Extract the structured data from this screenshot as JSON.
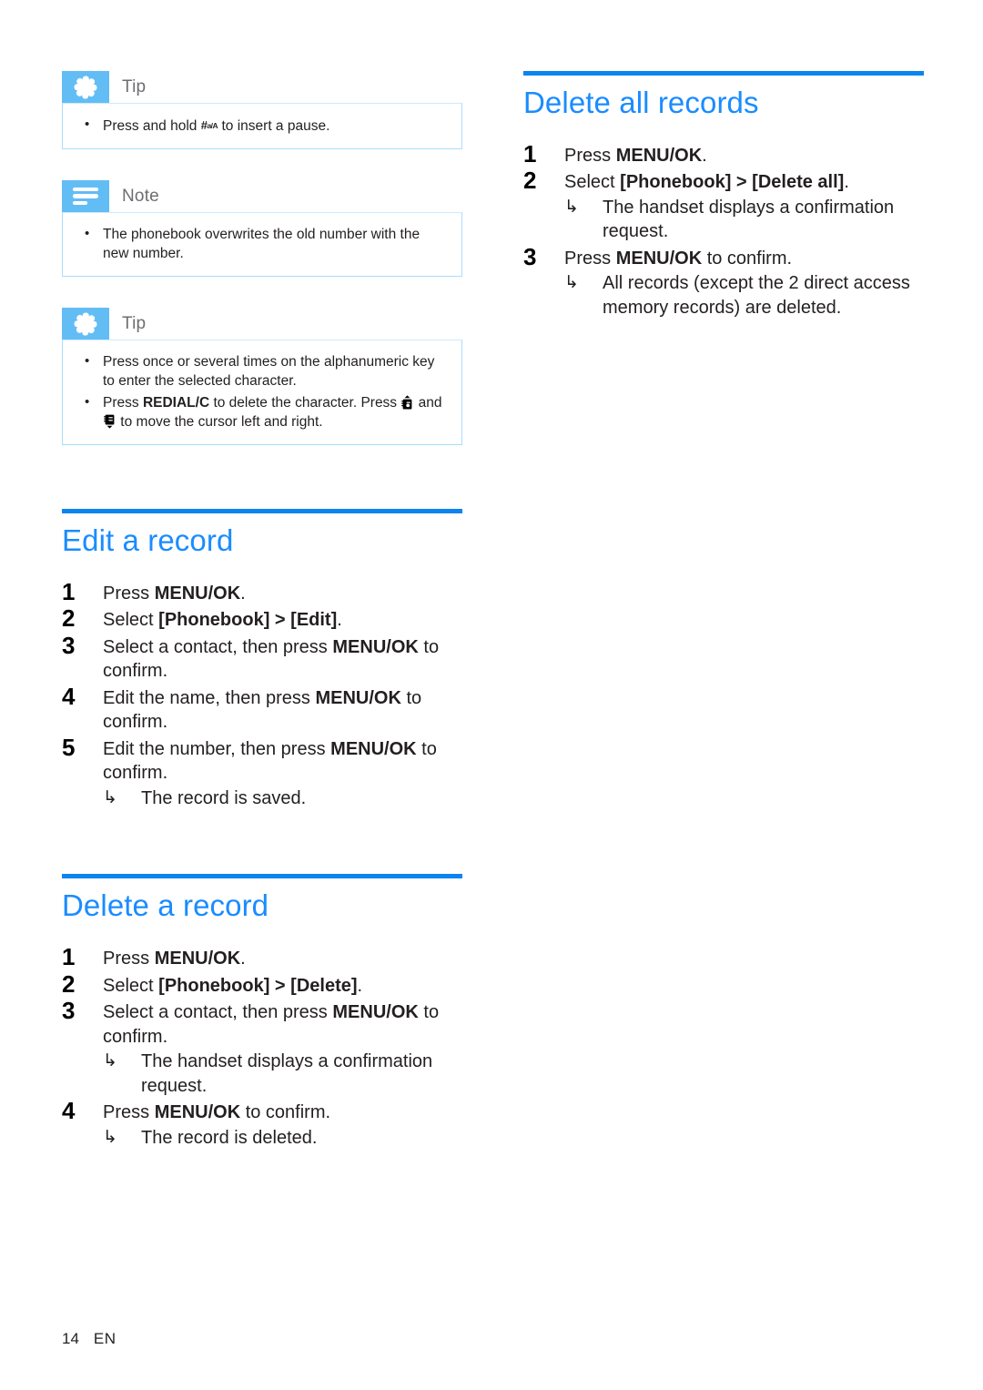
{
  "page": {
    "number": "14",
    "language": "EN"
  },
  "colors": {
    "heading_blue": "#1a8cff",
    "rule_blue": "#0c84ef",
    "callout_blue": "#63bdf5",
    "callout_border": "#a9ddfb"
  },
  "callouts": [
    {
      "type": "tip",
      "icon": "asterisk-icon",
      "title": "Tip",
      "items": [
        {
          "prefix": "Press and hold ",
          "glyph": "hash-key-icon",
          "glyph_label": "#",
          "glyph_sub": "a/A",
          "suffix": " to insert a pause."
        }
      ]
    },
    {
      "type": "note",
      "icon": "lines-icon",
      "title": "Note",
      "items": [
        {
          "text": "The phonebook overwrites the old number with the new number."
        }
      ]
    },
    {
      "type": "tip",
      "icon": "asterisk-icon",
      "title": "Tip",
      "items": [
        {
          "text": "Press once or several times on the alphanumeric key to enter the selected character."
        },
        {
          "rich": true,
          "p1": "Press ",
          "bold1": "REDIAL/C",
          "p2": " to delete the character. Press ",
          "glyph1": "phonebook-up-icon",
          "p3": " and ",
          "glyph2": "phonebook-down-icon",
          "p4": " to move the cursor left and right."
        }
      ]
    }
  ],
  "sections": {
    "edit_a_record": {
      "heading": "Edit a record",
      "steps": [
        {
          "num": "1",
          "p1": "Press ",
          "bold": "MENU/OK",
          "p2": "."
        },
        {
          "num": "2",
          "p1": "Select ",
          "bold": "[Phonebook] > [Edit]",
          "p2": "."
        },
        {
          "num": "3",
          "p1": "Select a contact, then press ",
          "bold": "MENU/OK",
          "p2": " to confirm."
        },
        {
          "num": "4",
          "p1": "Edit the name, then press ",
          "bold": "MENU/OK",
          "p2": " to confirm.",
          "result": "The record is saved.",
          "result_hidden": true
        },
        {
          "num": "5",
          "p1": "Edit the number, then press ",
          "bold": "MENU/OK",
          "p2": " to confirm.",
          "result": "The record is saved."
        }
      ]
    },
    "delete_a_record": {
      "heading": "Delete a record",
      "steps": [
        {
          "num": "1",
          "p1": "Press ",
          "bold": "MENU/OK",
          "p2": "."
        },
        {
          "num": "2",
          "p1": "Select ",
          "bold": "[Phonebook] > [Delete]",
          "p2": "."
        },
        {
          "num": "3",
          "p1": "Select a contact, then press ",
          "bold": "MENU/OK",
          "p2": " to confirm.",
          "result": "The handset displays a confirmation request."
        },
        {
          "num": "4",
          "p1": "Press ",
          "bold": "MENU/OK",
          "p2": " to confirm.",
          "result": "The record is deleted."
        }
      ]
    },
    "delete_all_records": {
      "heading": "Delete all records",
      "steps": [
        {
          "num": "1",
          "p1": "Press ",
          "bold": "MENU/OK",
          "p2": "."
        },
        {
          "num": "2",
          "p1": "Select ",
          "bold": "[Phonebook] > [Delete all]",
          "p2": ".",
          "result": "The handset displays a confirmation request."
        },
        {
          "num": "3",
          "p1": "Press ",
          "bold": "MENU/OK",
          "p2": " to confirm.",
          "result": "All records (except the 2 direct access memory records) are deleted."
        }
      ]
    }
  },
  "arrow_glyph": "↳"
}
